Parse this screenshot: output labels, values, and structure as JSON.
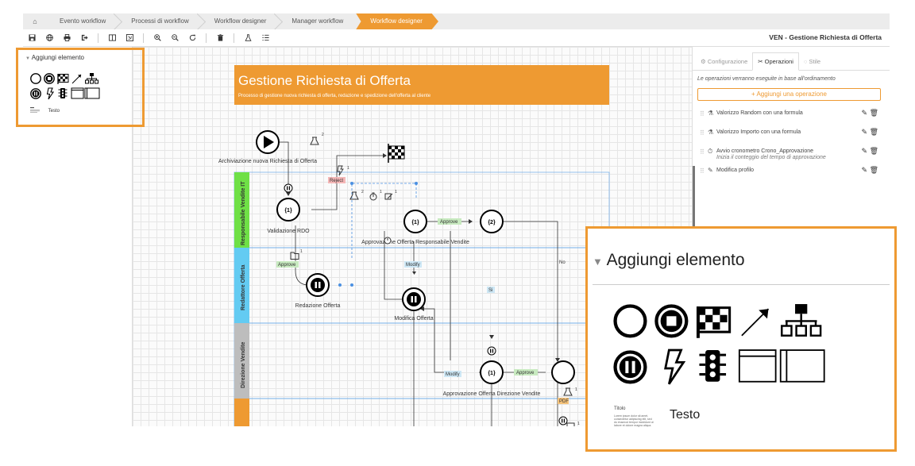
{
  "breadcrumb": {
    "home": "⌂",
    "items": [
      "Evento workflow",
      "Processi di workflow",
      "Workflow designer",
      "Manager workflow"
    ],
    "active": "Workflow designer"
  },
  "toolbar": {
    "doc_title": "VEN - Gestione Richiesta di Offerta"
  },
  "palette": {
    "heading": "Aggiungi elemento",
    "text_tool": "Testo",
    "title_tool": "Titolo",
    "lorem": "Lorem ipsum dolor sit amet, consectetur adipiscing elit, sed do eiusmod tempor incididunt ut labore et dolore magna aliqua."
  },
  "canvas": {
    "banner_title": "Gestione Richiesta di Offerta",
    "banner_subtitle": "Processo di gestione nuova richiesta di offerta, redazione e spedizione dell'offerta al cliente",
    "lanes": [
      "Responsabile Vendite IT",
      "Redattore Offerta",
      "Direzione Vendite"
    ],
    "nodes": {
      "start": "Archiviazione nuova Richiesta di Offerta",
      "rdo": "Validazione RDO",
      "redazione": "Redazione Offerta",
      "appr_resp": "Approvazione Offerta Responsabile Vendite",
      "modifica": "Modifica Offerta",
      "appr_dir": "Approvazione Offerta Direzione Vendite"
    },
    "counters": {
      "c1": "{1}",
      "c2": "{2}"
    },
    "badges": {
      "b1": "1",
      "b2": "2"
    },
    "edges": {
      "reject": "Reject",
      "approve": "Approve",
      "modify": "Modify",
      "si": "Si",
      "no": "No",
      "pdf": "PDF"
    }
  },
  "panel": {
    "tabs": [
      "Configurazione",
      "Operazioni",
      "Stile"
    ],
    "info": "Le operazioni verranno eseguite in base all'ordinamento",
    "add_button": "+ Aggiungi una operazione",
    "operations": [
      {
        "label": "Valorizzo Random con una formula",
        "sub": ""
      },
      {
        "label": "Valorizzo Importo con una formula",
        "sub": ""
      },
      {
        "label": "Avvio cronometro Crono_Approvazione",
        "sub": "Inizia il conteggio del tempo di approvazione"
      },
      {
        "label": "Modifica profilo",
        "sub": ""
      }
    ]
  },
  "colors": {
    "accent": "#ee9a32",
    "lane_green": "#6fe046",
    "lane_blue": "#63cbf2",
    "lane_grey": "#bdbdbd",
    "lane_orange": "#ee9a32"
  }
}
